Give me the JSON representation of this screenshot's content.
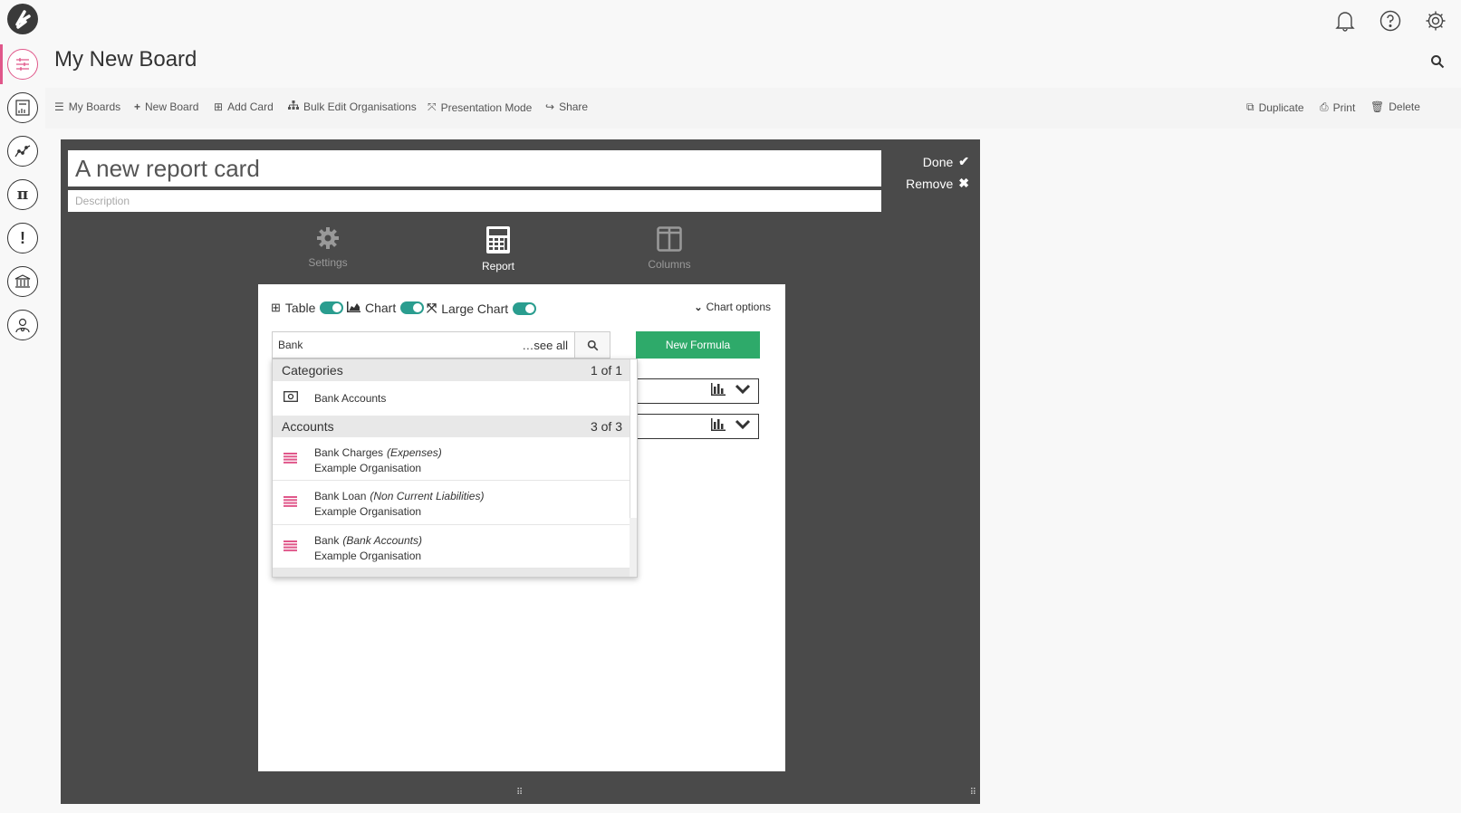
{
  "app": {
    "board_title": "My New Board"
  },
  "rail": {
    "items": [
      "boards-icon",
      "pdf-report-icon",
      "trend-chart-icon",
      "pi-formula-icon",
      "alert-icon",
      "bank-icon",
      "user-settings-icon"
    ]
  },
  "top_icons": [
    "bell-icon",
    "help-icon",
    "gear-icon"
  ],
  "toolbar": {
    "my_boards": "My Boards",
    "new_board": "New Board",
    "add_card": "Add Card",
    "bulk_edit": "Bulk Edit Organisations",
    "presentation": "Presentation Mode",
    "share": "Share",
    "duplicate": "Duplicate",
    "print": "Print",
    "delete": "Delete"
  },
  "card": {
    "title": "A new report card",
    "description_placeholder": "Description",
    "done_label": "Done",
    "remove_label": "Remove",
    "tabs": [
      {
        "label": "Settings",
        "active": false
      },
      {
        "label": "Report",
        "active": true
      },
      {
        "label": "Columns",
        "active": false
      }
    ]
  },
  "panel": {
    "toggles": [
      {
        "label": "Table",
        "on": true
      },
      {
        "label": "Chart",
        "on": true
      },
      {
        "label": "Large Chart",
        "on": true
      }
    ],
    "chart_options_label": "Chart options",
    "search_value": "Bank",
    "see_all_label": "…see all",
    "new_formula_label": "New Formula"
  },
  "dropdown": {
    "categories_header": "Categories",
    "categories_count": "1 of 1",
    "categories": [
      {
        "name": "Bank Accounts"
      }
    ],
    "accounts_header": "Accounts",
    "accounts_count": "3 of 3",
    "accounts": [
      {
        "name": "Bank Charges",
        "type": "(Expenses)",
        "org": "Example Organisation"
      },
      {
        "name": "Bank Loan",
        "type": "(Non Current Liabilities)",
        "org": "Example Organisation"
      },
      {
        "name": "Bank",
        "type": "(Bank Accounts)",
        "org": "Example Organisation"
      }
    ]
  },
  "colors": {
    "accent": "#e0578a",
    "toggle": "#2a9d8f",
    "primary_button": "#2eaa6a",
    "card_bg": "#4a4a4a"
  }
}
